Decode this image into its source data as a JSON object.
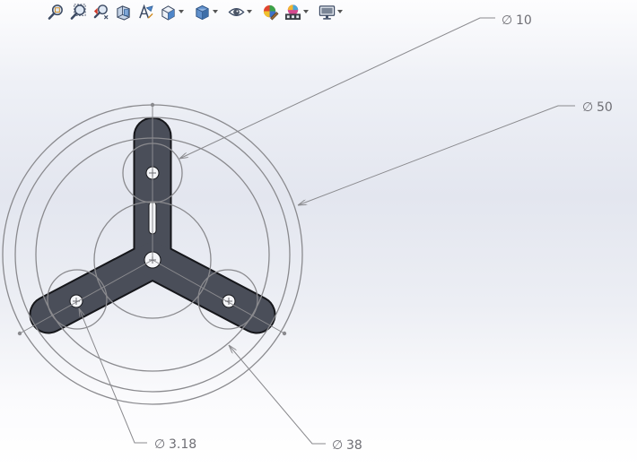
{
  "toolbar": {
    "buttons": [
      {
        "name": "zoom-to-fit-icon",
        "has_menu": false
      },
      {
        "name": "zoom-to-area-icon",
        "has_menu": false
      },
      {
        "name": "previous-view-icon",
        "has_menu": false
      },
      {
        "name": "section-view-icon",
        "has_menu": false
      },
      {
        "name": "dynamic-annotation-views-icon",
        "has_menu": false
      },
      {
        "name": "view-orientation-icon",
        "has_menu": true
      },
      {
        "name": "display-style-icon",
        "has_menu": true
      },
      {
        "name": "hide-show-items-icon",
        "has_menu": true
      },
      {
        "name": "edit-appearance-icon",
        "has_menu": false
      },
      {
        "name": "apply-scene-icon",
        "has_menu": true
      },
      {
        "name": "view-settings-icon",
        "has_menu": true
      }
    ]
  },
  "dimensions": {
    "hole_diameter": "10",
    "outer_diameter": "50",
    "small_hole_diameter": "3.18",
    "mid_diameter": "38",
    "diameter_symbol": "∅"
  },
  "colors": {
    "part_fill": "#4a4e59",
    "part_edge": "#15161a",
    "sketch_line": "#8a8a8e",
    "dimension_text": "#6e6e74"
  }
}
